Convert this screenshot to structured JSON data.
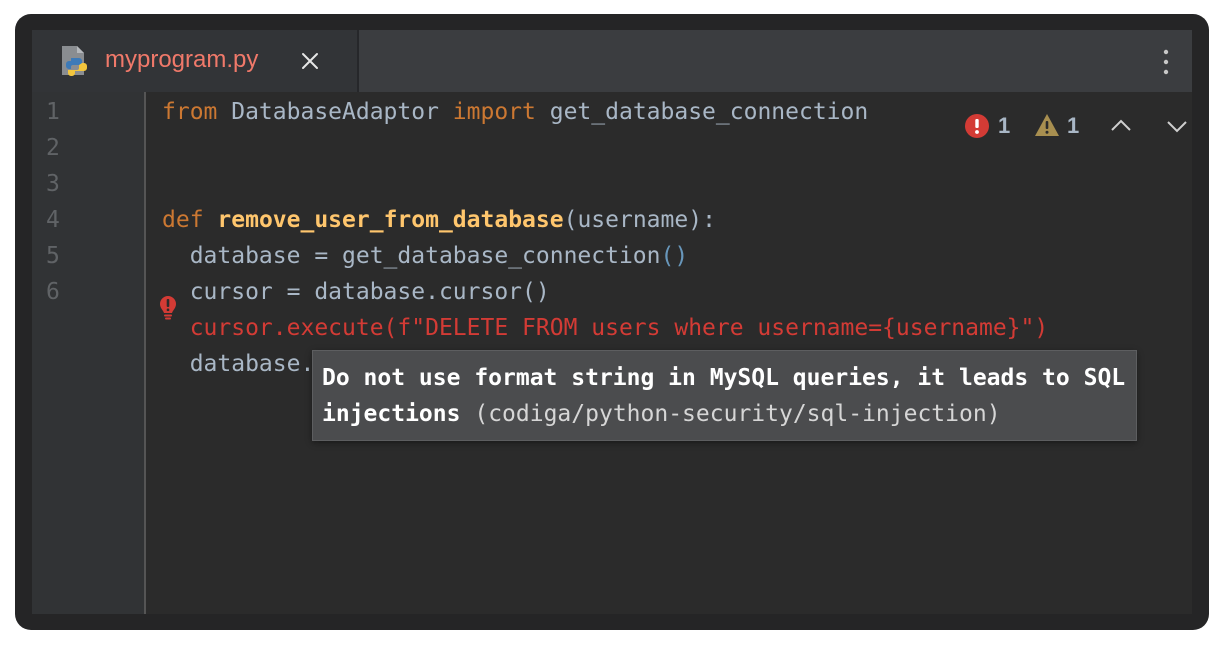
{
  "tab": {
    "filename": "myprogram.py",
    "icon": "python-file-icon",
    "close_icon": "close-icon"
  },
  "toolbar": {
    "more_icon": "more-vertical-icon"
  },
  "inspection": {
    "error_count": "1",
    "warning_count": "1",
    "error_icon": "error-icon",
    "warning_icon": "warning-icon",
    "prev_icon": "chevron-up-icon",
    "next_icon": "chevron-down-icon",
    "error_color": "#d33b35",
    "warning_color": "#a88f50"
  },
  "line_numbers": [
    "1",
    "2",
    "3",
    "4",
    "5",
    "6"
  ],
  "code": {
    "line1": {
      "kw_from": "from",
      "module": " DatabaseAdaptor ",
      "kw_import": "import",
      "name": " get_database_connection"
    },
    "line4": {
      "kw_def": "def",
      "func_name": "remove_user_from_database",
      "params": "(username):"
    },
    "line5": {
      "text": "  database = get_database_connection",
      "parens": "()"
    },
    "line6": {
      "text": "  cursor = database.cursor()"
    },
    "line7": {
      "text": "  cursor.execute(f\"DELETE FROM users where username={username}\")"
    },
    "line8": {
      "text": "  database."
    }
  },
  "tooltip": {
    "message": "Do not use format string in MySQL queries, it leads to SQL injections",
    "rule": "(codiga/python-security/sql-injection)"
  },
  "colors": {
    "background": "#2b2b2b",
    "keyword": "#cc7832",
    "function": "#ffc66d",
    "text": "#a9b7c6",
    "error_text": "#d33b35",
    "tab_label": "#f0796a"
  }
}
